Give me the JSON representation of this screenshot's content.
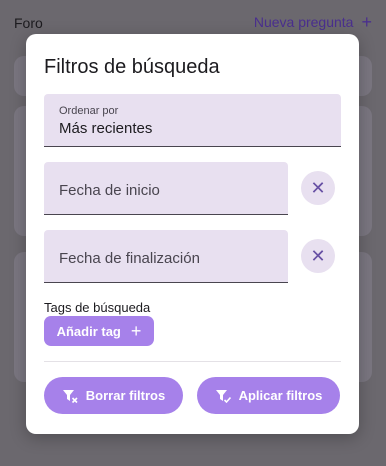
{
  "header": {
    "title": "Foro",
    "new_question_label": "Nueva pregunta",
    "new_question_icon": "plus-icon"
  },
  "modal": {
    "title": "Filtros de búsqueda",
    "sort": {
      "label": "Ordenar por",
      "value": "Más recientes"
    },
    "start_date": {
      "placeholder": "Fecha de inicio",
      "clear_icon": "close-icon"
    },
    "end_date": {
      "placeholder": "Fecha de finalización",
      "clear_icon": "close-icon"
    },
    "tags": {
      "label": "Tags de búsqueda",
      "add_label": "Añadir tag",
      "add_icon": "plus-icon"
    },
    "buttons": {
      "clear_label": "Borrar filtros",
      "clear_icon": "filter-remove-icon",
      "apply_label": "Aplicar filtros",
      "apply_icon": "filter-check-icon"
    }
  },
  "colors": {
    "accent": "#a681ea",
    "field_bg": "#e8e0f0",
    "icon": "#6750a4",
    "overlay": "#6b686e"
  }
}
